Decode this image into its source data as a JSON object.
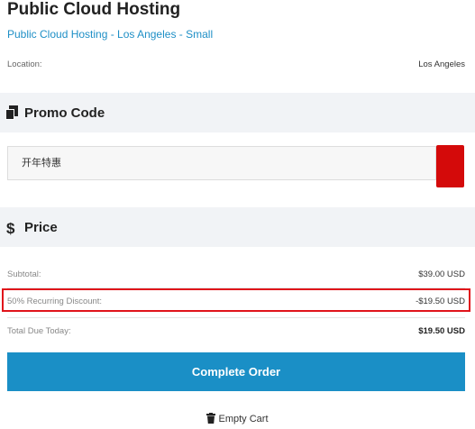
{
  "product": {
    "title": "Public Cloud Hosting",
    "subtitle": "Public Cloud Hosting - Los Angeles - Small"
  },
  "location": {
    "label": "Location:",
    "value": "Los Angeles"
  },
  "promo": {
    "header": "Promo Code",
    "header_icon": "copy-icon",
    "input_value": "开年特惠",
    "apply_button_color": "#d40a0a"
  },
  "price": {
    "header": "Price",
    "header_icon": "dollar-icon",
    "subtotal_label": "Subtotal:",
    "subtotal_value": "$39.00 USD",
    "discount_label": "50% Recurring Discount:",
    "discount_value": "-$19.50 USD",
    "total_label": "Total Due Today:",
    "total_value": "$19.50 USD"
  },
  "actions": {
    "complete_label": "Complete Order",
    "empty_cart_label": "Empty Cart"
  },
  "colors": {
    "accent": "#1a8fc6",
    "highlight": "#e0141b"
  }
}
